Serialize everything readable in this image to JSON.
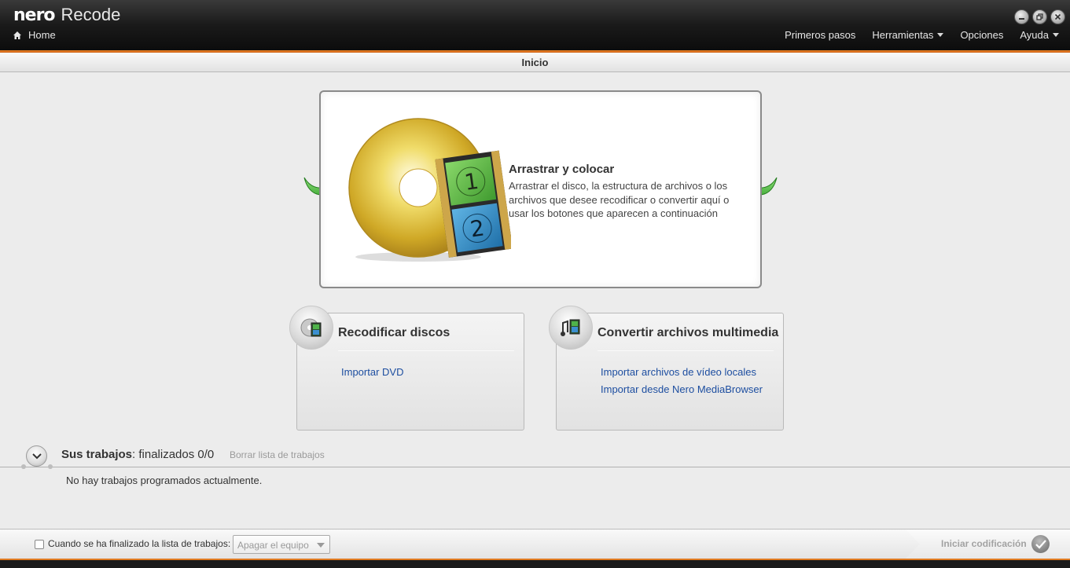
{
  "app": {
    "brand_nero": "nero",
    "brand_recode": "Recode"
  },
  "header": {
    "home_label": "Home",
    "nav": [
      {
        "label": "Primeros pasos"
      },
      {
        "label": "Herramientas"
      },
      {
        "label": "Opciones"
      },
      {
        "label": "Ayuda"
      }
    ]
  },
  "page": {
    "title": "Inicio"
  },
  "dropzone": {
    "title": "Arrastrar y colocar",
    "description": "Arrastrar el disco, la estructura de archivos o los archivos que desee recodificar o convertir aquí o usar los botones que aparecen a continuación"
  },
  "cards": {
    "recode": {
      "title": "Recodificar discos",
      "links": [
        "Importar DVD"
      ]
    },
    "convert": {
      "title": "Convertir archivos multimedia",
      "links": [
        "Importar archivos de vídeo locales",
        "Importar desde Nero MediaBrowser"
      ]
    }
  },
  "jobs": {
    "title": "Sus trabajos",
    "status": ": finalizados 0/0",
    "clear_label": "Borrar lista de trabajos",
    "empty_message": "No hay trabajos programados actualmente."
  },
  "footer": {
    "checkbox_label": "Cuando se ha finalizado la lista de trabajos:",
    "action_select_value": "Apagar el equipo",
    "start_label": "Iniciar codificación"
  },
  "colors": {
    "accent_orange": "#f08a2a",
    "link_blue": "#1d4ea0",
    "arrow_green": "#43b236"
  }
}
